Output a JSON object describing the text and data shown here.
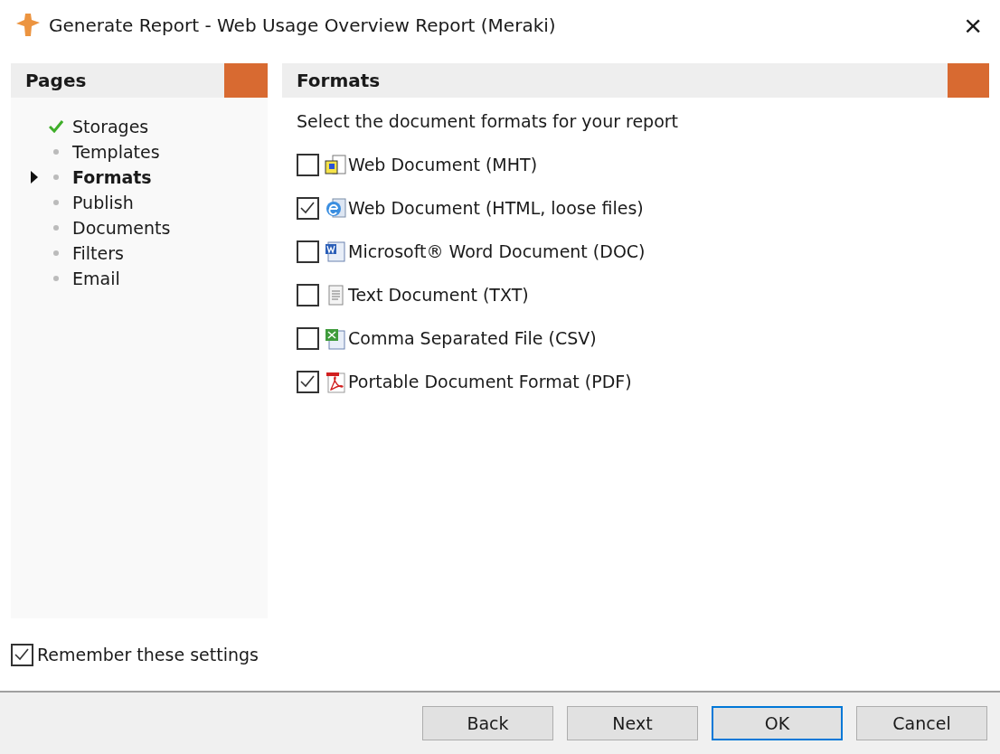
{
  "window": {
    "title": "Generate Report - Web Usage Overview Report (Meraki)",
    "close": "×"
  },
  "pages": {
    "title": "Pages",
    "items": [
      {
        "label": "Storages",
        "kind": "done",
        "selected": false
      },
      {
        "label": "Templates",
        "kind": "pending",
        "selected": false
      },
      {
        "label": "Formats",
        "kind": "pending",
        "selected": true
      },
      {
        "label": "Publish",
        "kind": "pending",
        "selected": false
      },
      {
        "label": "Documents",
        "kind": "pending",
        "selected": false
      },
      {
        "label": "Filters",
        "kind": "pending",
        "selected": false
      },
      {
        "label": "Email",
        "kind": "pending",
        "selected": false
      }
    ]
  },
  "formats": {
    "title": "Formats",
    "instruction": "Select the document formats for your report",
    "items": [
      {
        "label": "Web Document (MHT)",
        "kind": "mht",
        "checked": false
      },
      {
        "label": "Web Document (HTML, loose files)",
        "kind": "html",
        "checked": true
      },
      {
        "label": "Microsoft® Word Document (DOC)",
        "kind": "doc",
        "checked": false
      },
      {
        "label": "Text Document (TXT)",
        "kind": "txt",
        "checked": false
      },
      {
        "label": "Comma Separated File (CSV)",
        "kind": "csv",
        "checked": false
      },
      {
        "label": "Portable Document Format (PDF)",
        "kind": "pdf",
        "checked": true
      }
    ]
  },
  "remember": {
    "label": "Remember these settings",
    "checked": true
  },
  "buttons": [
    {
      "label": "Back",
      "default": false
    },
    {
      "label": "Next",
      "default": false
    },
    {
      "label": "OK",
      "default": true
    },
    {
      "label": "Cancel",
      "default": false
    }
  ]
}
